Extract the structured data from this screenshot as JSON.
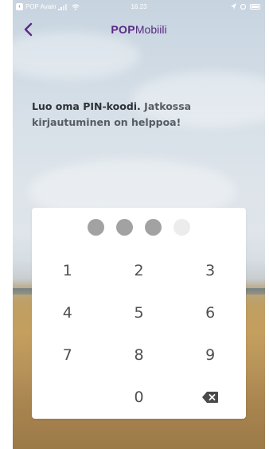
{
  "status_bar": {
    "back_app": "POP Avain",
    "time": "16.23"
  },
  "nav": {
    "back_icon": "chevron-left-icon",
    "brand_bold": "POP",
    "brand_light": "Mobiili"
  },
  "prompt": {
    "strong": "Luo oma PIN-koodi.",
    "rest": " Jatkossa kirjautuminen on helppoa!"
  },
  "pin": {
    "length": 4,
    "entered": 3
  },
  "keypad": {
    "rows": [
      [
        "1",
        "2",
        "3"
      ],
      [
        "4",
        "5",
        "6"
      ],
      [
        "7",
        "8",
        "9"
      ],
      [
        "",
        "0",
        "backspace"
      ]
    ]
  },
  "colors": {
    "brand": "#5a2a86",
    "dot_filled": "#a2a2a2",
    "dot_empty": "#ececec"
  }
}
